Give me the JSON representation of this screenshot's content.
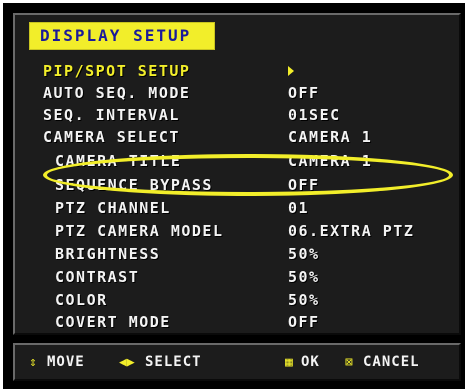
{
  "menu": {
    "title": "DISPLAY SETUP",
    "rows": [
      {
        "label": "PIP/SPOT SETUP",
        "value": "",
        "highlighted": true,
        "has_submenu": true
      },
      {
        "label": "AUTO SEQ. MODE",
        "value": "OFF"
      },
      {
        "label": "SEQ. INTERVAL",
        "value": "01SEC"
      },
      {
        "label": "CAMERA SELECT",
        "value": "CAMERA 1"
      },
      {
        "label": "CAMERA TITLE",
        "value": "CAMERA 1"
      },
      {
        "label": "SEQUENCE BYPASS",
        "value": "OFF"
      },
      {
        "label": "PTZ CHANNEL",
        "value": "01"
      },
      {
        "label": "PTZ CAMERA MODEL",
        "value": "06.EXTRA PTZ"
      },
      {
        "label": "BRIGHTNESS",
        "value": "50%"
      },
      {
        "label": "CONTRAST",
        "value": "50%"
      },
      {
        "label": "COLOR",
        "value": "50%"
      },
      {
        "label": "COVERT MODE",
        "value": "OFF"
      }
    ]
  },
  "footer": {
    "move_icon": "up-down-arrows-icon",
    "move": "MOVE",
    "select_icon": "left-right-arrows-icon",
    "select": "SELECT",
    "ok_icon": "square-icon",
    "ok": "OK",
    "cancel_icon": "boxed-x-icon",
    "cancel": "CANCEL"
  },
  "colors": {
    "accent": "#f2ee2a",
    "title_text": "#1a1a9a",
    "text": "#f4f4f4",
    "panel": "#1c1c1c"
  }
}
